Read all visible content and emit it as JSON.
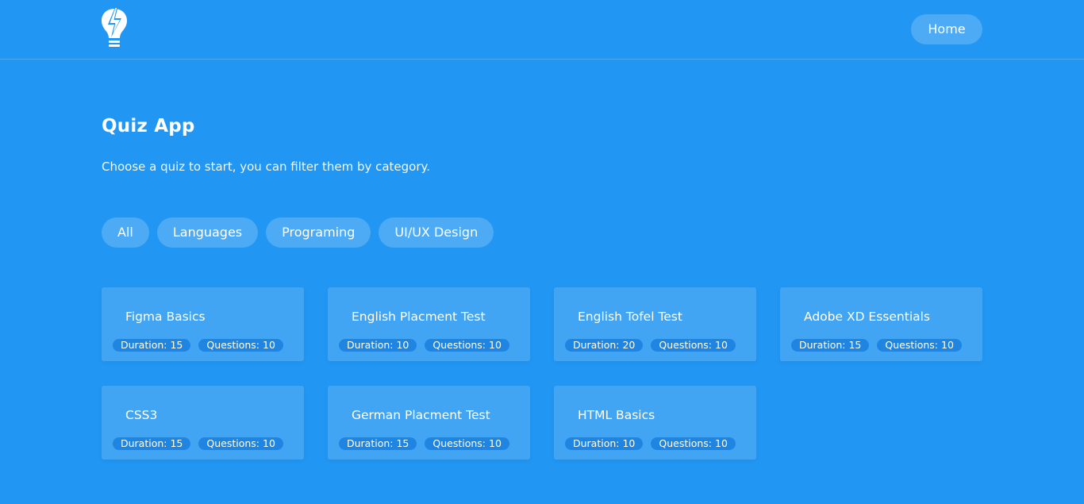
{
  "header": {
    "logo_icon": "lightbulb-bolt-icon",
    "home_label": "Home"
  },
  "main": {
    "title": "Quiz App",
    "subtitle": "Choose a quiz to start, you can filter them by category.",
    "filters": [
      "All",
      "Languages",
      "Programing",
      "UI/UX Design"
    ],
    "quizzes": [
      {
        "title": "Figma Basics",
        "duration": "Duration: 15",
        "questions": "Questions: 10"
      },
      {
        "title": "English Placment Test",
        "duration": "Duration: 10",
        "questions": "Questions: 10"
      },
      {
        "title": "English Tofel Test",
        "duration": "Duration: 20",
        "questions": "Questions: 10"
      },
      {
        "title": "Adobe XD Essentials",
        "duration": "Duration: 15",
        "questions": "Questions: 10"
      },
      {
        "title": "CSS3",
        "duration": "Duration: 15",
        "questions": "Questions: 10"
      },
      {
        "title": "German Placment Test",
        "duration": "Duration: 15",
        "questions": "Questions: 10"
      },
      {
        "title": "HTML Basics",
        "duration": "Duration: 10",
        "questions": "Questions: 10"
      }
    ]
  },
  "colors": {
    "background": "#2196f3",
    "tag_background": "#1f85e1",
    "text": "#ffffff"
  }
}
